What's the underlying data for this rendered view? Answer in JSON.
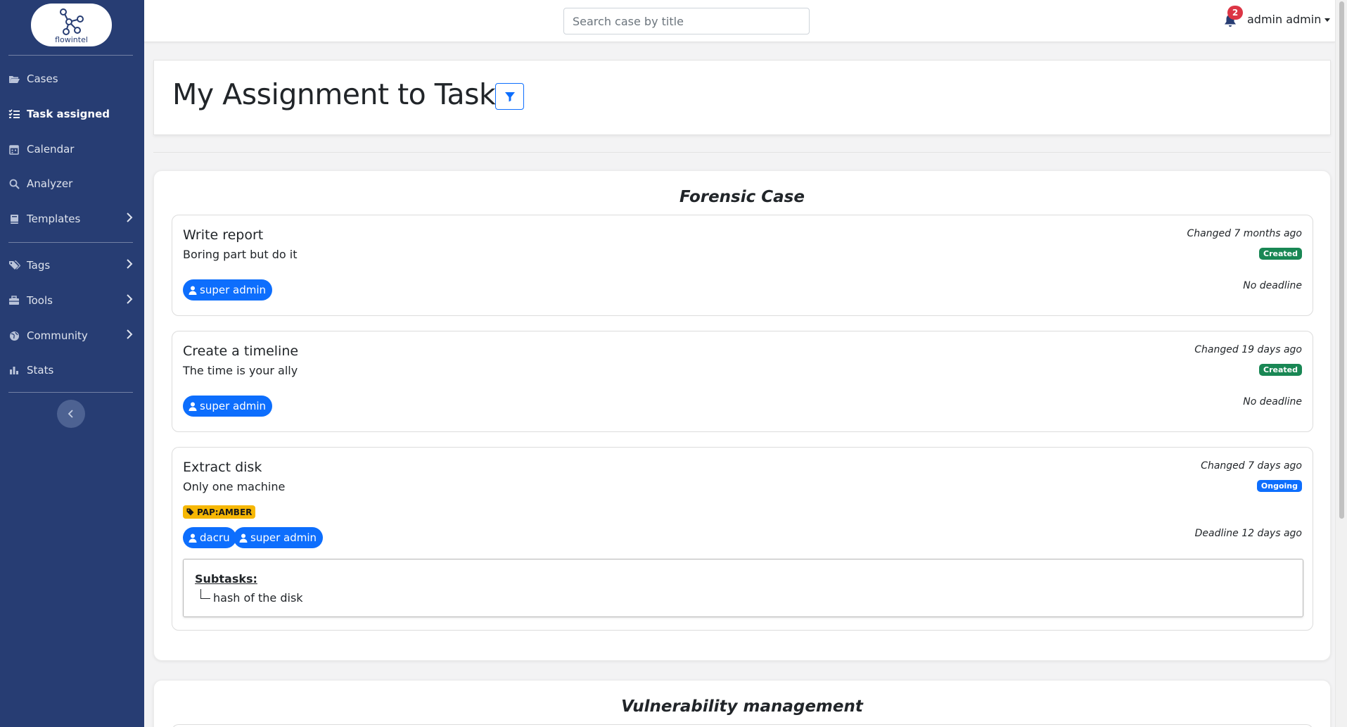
{
  "app": {
    "logo_text": "flowintel"
  },
  "sidebar": {
    "items": [
      {
        "label": "Cases",
        "icon": "folder-open-icon"
      },
      {
        "label": "Task assigned",
        "icon": "list-check-icon"
      },
      {
        "label": "Calendar",
        "icon": "calendar-icon"
      },
      {
        "label": "Analyzer",
        "icon": "magnifier-icon"
      },
      {
        "label": "Templates",
        "icon": "book-icon"
      },
      {
        "label": "Tags",
        "icon": "tags-icon"
      },
      {
        "label": "Tools",
        "icon": "toolbox-icon"
      },
      {
        "label": "Community",
        "icon": "globe-icon"
      },
      {
        "label": "Stats",
        "icon": "bar-chart-icon"
      }
    ]
  },
  "topbar": {
    "search_placeholder": "Search case by title",
    "notification_count": "2",
    "user_name": "admin admin"
  },
  "page": {
    "title": "My Assignment to Tasks"
  },
  "cases": [
    {
      "title": "Forensic Case",
      "tasks": [
        {
          "title": "Write report",
          "description": "Boring part but do it",
          "changed": "Changed 7 months ago",
          "status": "Created",
          "deadline": "No deadline",
          "users": [
            "super admin"
          ]
        },
        {
          "title": "Create a timeline",
          "description": "The time is your ally",
          "changed": "Changed 19 days ago",
          "status": "Created",
          "deadline": "No deadline",
          "users": [
            "super admin"
          ]
        },
        {
          "title": "Extract disk",
          "description": "Only one machine",
          "changed": "Changed 7 days ago",
          "status": "Ongoing",
          "deadline": "Deadline 12 days ago",
          "tag": "PAP:AMBER",
          "users": [
            "dacru",
            "super admin"
          ],
          "subtasks_label": "Subtasks:",
          "subtasks": [
            "hash of the disk"
          ]
        }
      ]
    },
    {
      "title": "Vulnerability management"
    }
  ],
  "colors": {
    "sidebar_bg": "#273d73",
    "primary": "#0d6efd",
    "success": "#198754",
    "tag_amber": "#f6b704",
    "danger": "#dc3545"
  }
}
